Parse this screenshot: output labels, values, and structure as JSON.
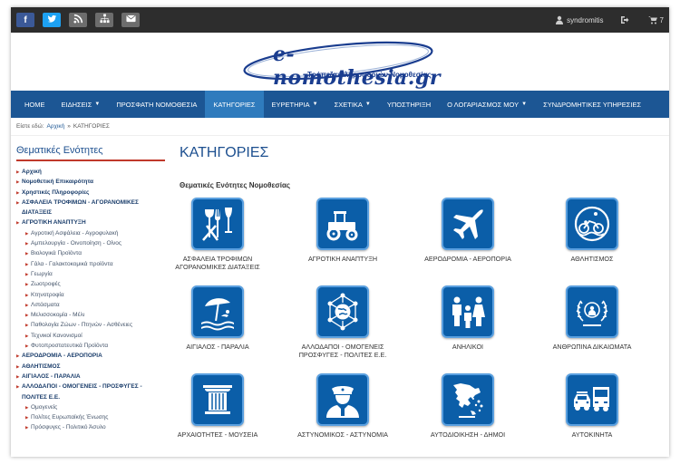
{
  "topbar": {
    "social": [
      {
        "name": "facebook-icon",
        "glyph": "f",
        "color": "#3b5998"
      },
      {
        "name": "twitter-icon",
        "glyph": "",
        "color": "#1da1f2"
      },
      {
        "name": "rss-icon",
        "glyph": "",
        "color": "#6d6d6d"
      },
      {
        "name": "sitemap-icon",
        "glyph": "",
        "color": "#6d6d6d"
      },
      {
        "name": "mail-icon",
        "glyph": "",
        "color": "#6d6d6d"
      }
    ],
    "username": "syndromitis",
    "cart_count": "7"
  },
  "logo": {
    "brand": "e-nomothesia.gr",
    "tagline": "Τράπεζα Πληροφοριών Νομοθεσίας"
  },
  "nav": {
    "items": [
      {
        "label": "HOME",
        "caret": false,
        "active": false
      },
      {
        "label": "ΕΙΔΗΣΕΙΣ",
        "caret": true,
        "active": false
      },
      {
        "label": "ΠΡΟΣΦΑΤΗ ΝΟΜΟΘΕΣΙΑ",
        "caret": false,
        "active": false
      },
      {
        "label": "ΚΑΤΗΓΟΡΙΕΣ",
        "caret": false,
        "active": true
      },
      {
        "label": "ΕΥΡΕΤΗΡΙΑ",
        "caret": true,
        "active": false
      },
      {
        "label": "ΣΧΕΤΙΚΑ",
        "caret": true,
        "active": false
      },
      {
        "label": "ΥΠΟΣΤΗΡΙΞΗ",
        "caret": false,
        "active": false
      },
      {
        "label": "Ο ΛΟΓΑΡΙΑΣΜΟΣ ΜΟΥ",
        "caret": true,
        "active": false
      },
      {
        "label": "ΣΥΝΔΡΟΜΗΤΙΚΕΣ ΥΠΗΡΕΣΙΕΣ",
        "caret": false,
        "active": false
      }
    ]
  },
  "breadcrumb": {
    "prefix": "Είστε εδώ:",
    "home": "Αρχική",
    "separator": "»",
    "current": "ΚΑΤΗΓΟΡΙΕΣ"
  },
  "sidebar": {
    "title": "Θεματικές Ενότητες",
    "items": [
      {
        "label": "Αρχική",
        "sub": false
      },
      {
        "label": "Νομοθετική Επικαιρότητα",
        "sub": false
      },
      {
        "label": "Χρηστικές Πληροφορίες",
        "sub": false
      },
      {
        "label": "ΑΣΦΑΛΕΙΑ ΤΡΟΦΙΜΩΝ - ΑΓΟΡΑΝΟΜΙΚΕΣ ΔΙΑΤΑΞΕΙΣ",
        "sub": false
      },
      {
        "label": "ΑΓΡΟΤΙΚΗ ΑΝΑΠΤΥΞΗ",
        "sub": false
      },
      {
        "label": "Αγροτική Ασφάλεια - Αγροφυλακή",
        "sub": true
      },
      {
        "label": "Αμπελουργία - Οινοποίηση - Οίνος",
        "sub": true
      },
      {
        "label": "Βιολογικά Προϊόντα",
        "sub": true
      },
      {
        "label": "Γάλα - Γαλακτοκομικά προϊόντα",
        "sub": true
      },
      {
        "label": "Γεωργία",
        "sub": true
      },
      {
        "label": "Ζωοτροφές",
        "sub": true
      },
      {
        "label": "Κτηνοτροφία",
        "sub": true
      },
      {
        "label": "Λιπάσματα",
        "sub": true
      },
      {
        "label": "Μελισσοκομία - Μέλι",
        "sub": true
      },
      {
        "label": "Παθολογία Ζώων - Πτηνών - Ασθένειες",
        "sub": true
      },
      {
        "label": "Τεχνικοί Κανονισμοί",
        "sub": true
      },
      {
        "label": "Φυτοπροστατευτικά Προϊόντα",
        "sub": true
      },
      {
        "label": "ΑΕΡΟΔΡΟΜΙΑ - ΑΕΡΟΠΟΡΙΑ",
        "sub": false
      },
      {
        "label": "ΑΘΛΗΤΙΣΜΟΣ",
        "sub": false
      },
      {
        "label": "ΑΙΓΙΑΛΟΣ - ΠΑΡΑΛΙΑ",
        "sub": false
      },
      {
        "label": "ΑΛΛΟΔΑΠΟΙ - ΟΜΟΓΕΝΕΙΣ - ΠΡΟΣΦΥΓΕΣ - ΠΟΛΙΤΕΣ Ε.Ε.",
        "sub": false
      },
      {
        "label": "Ομογενείς",
        "sub": true
      },
      {
        "label": "Πολίτες Ευρωπαϊκής Ένωσης",
        "sub": true
      },
      {
        "label": "Πρόσφυγες - Πολιτικό Άσυλο",
        "sub": true
      }
    ]
  },
  "main": {
    "title": "ΚΑΤΗΓΟΡΙΕΣ",
    "subtitle": "Θεματικές Ενότητες Νομοθεσίας",
    "categories": [
      {
        "label": "ΑΣΦΑΛΕΙΑ ΤΡΟΦΙΜΩΝ ΑΓΟΡΑΝΟΜΙΚΕΣ ΔΙΑΤΑΞΕΙΣ",
        "icon": "food-safety-icon"
      },
      {
        "label": "ΑΓΡΟΤΙΚΗ ΑΝΑΠΤΥΞΗ",
        "icon": "tractor-icon"
      },
      {
        "label": "ΑΕΡΟΔΡΟΜΙΑ - ΑΕΡΟΠΟΡΙΑ",
        "icon": "airplane-icon"
      },
      {
        "label": "ΑΘΛΗΤΙΣΜΟΣ",
        "icon": "triathlon-icon"
      },
      {
        "label": "ΑΙΓΙΑΛΟΣ - ΠΑΡΑΛΙΑ",
        "icon": "beach-icon"
      },
      {
        "label": "ΑΛΛΟΔΑΠΟΙ - ΟΜΟΓΕΝΕΙΣ ΠΡΟΣΦΥΓΕΣ - ΠΟΛΙΤΕΣ Ε.Ε.",
        "icon": "globe-network-icon"
      },
      {
        "label": "ΑΝΗΛΙΚΟΙ",
        "icon": "family-icon"
      },
      {
        "label": "ΑΝΘΡΩΠΙΝΑ ΔΙΚΑΙΩΜΑΤΑ",
        "icon": "un-emblem-icon"
      },
      {
        "label": "ΑΡΧΑΙΟΤΗΤΕΣ - ΜΟΥΣΕΙΑ",
        "icon": "column-icon"
      },
      {
        "label": "ΑΣΤΥΝΟΜΙΚΟΣ - ΑΣΤΥΝΟΜΙΑ",
        "icon": "police-officer-icon"
      },
      {
        "label": "ΑΥΤΟΔΙΟΙΚΗΣΗ - ΔΗΜΟΙ",
        "icon": "greece-map-icon"
      },
      {
        "label": "ΑΥΤΟΚΙΝΗΤΑ",
        "icon": "vehicles-icon"
      }
    ]
  },
  "colors": {
    "nav_bg": "#1c5694",
    "nav_active": "#2f7bbd",
    "tile_bg": "#0b5ea8",
    "accent_red": "#c0392b",
    "title_blue": "#1c4f8f"
  }
}
